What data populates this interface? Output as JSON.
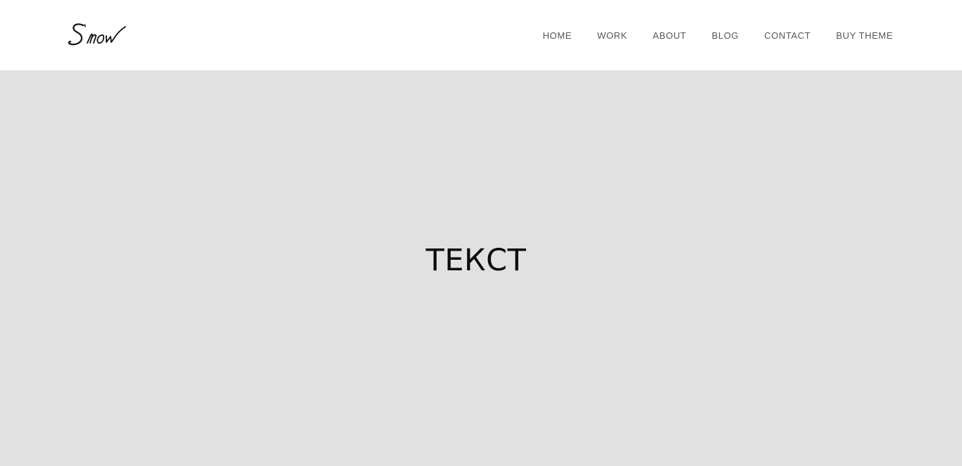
{
  "header": {
    "logo_text": "Snow",
    "nav": [
      {
        "label": "HOME"
      },
      {
        "label": "WORK"
      },
      {
        "label": "ABOUT"
      },
      {
        "label": "BLOG"
      },
      {
        "label": "CONTACT"
      },
      {
        "label": "BUY THEME"
      }
    ]
  },
  "hero": {
    "text": "ТЕКСТ",
    "background_color": "#e1e1e1"
  }
}
